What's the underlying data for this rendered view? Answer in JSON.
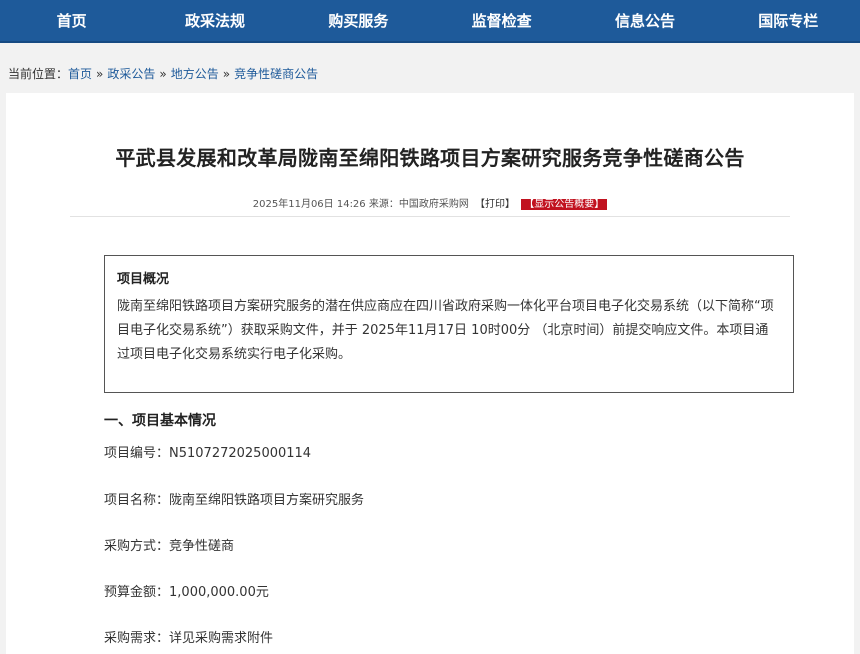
{
  "nav": [
    "首页",
    "政采法规",
    "购买服务",
    "监督检查",
    "信息公告",
    "国际专栏"
  ],
  "breadcrumb": {
    "prefix": "当前位置：",
    "items": [
      "首页",
      "政采公告",
      "地方公告",
      "竞争性磋商公告"
    ],
    "sep": "»"
  },
  "article": {
    "title": "平武县发展和改革局陇南至绵阳铁路项目方案研究服务竞争性磋商公告",
    "date": "2025年11月06日 14:26",
    "source": "来源：中国政府采购网",
    "print": "【打印】",
    "summary_tag": "【显示公告概要】"
  },
  "summary": {
    "heading": "项目概况",
    "body": "陇南至绵阳铁路项目方案研究服务的潜在供应商应在四川省政府采购一体化平台项目电子化交易系统（以下简称“项目电子化交易系统”）获取采购文件，并于 2025年11月17日 10时00分 （北京时间）前提交响应文件。本项目通过项目电子化交易系统实行电子化采购。"
  },
  "section1": {
    "heading": "一、项目基本情况",
    "rows": [
      {
        "label": "项目编号：",
        "value": "N5107272025000114"
      },
      {
        "label": "项目名称：",
        "value": "陇南至绵阳铁路项目方案研究服务"
      },
      {
        "label": "采购方式：",
        "value": "竞争性磋商"
      },
      {
        "label": "预算金额：",
        "value": "1,000,000.00元"
      },
      {
        "label": "采购需求：",
        "value": "详见采购需求附件"
      }
    ]
  },
  "colors": {
    "nav_bg": "#1e5a9a",
    "tag_bg": "#c1121f"
  }
}
